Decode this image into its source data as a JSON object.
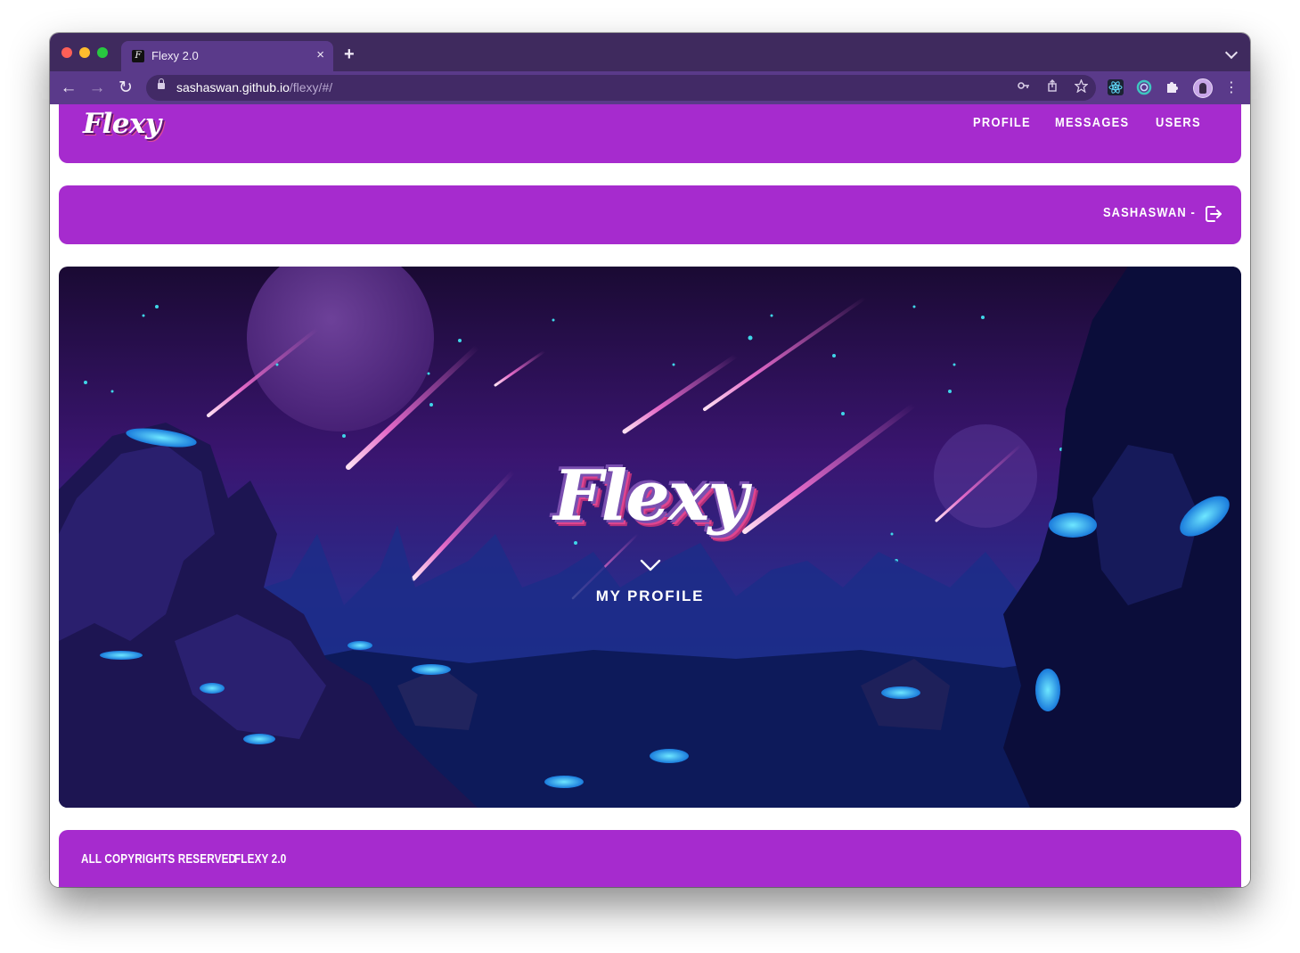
{
  "browser": {
    "tab_title": "Flexy 2.0",
    "tab_close": "×",
    "new_tab": "+",
    "url_domain": "sashaswan.github.io",
    "url_path": "/flexy/#/",
    "back": "←",
    "forward": "→",
    "reload": "↻",
    "menu": "⋮"
  },
  "header": {
    "logo": "Flexy",
    "nav": [
      {
        "label": "PROFILE"
      },
      {
        "label": "MESSAGES"
      },
      {
        "label": "USERS"
      }
    ]
  },
  "userbar": {
    "username": "SASHASWAN -"
  },
  "hero": {
    "title": "Flexy",
    "link": "MY PROFILE"
  },
  "footer": {
    "copyright": "ALL COPYRIGHTS RESERVED",
    "version": "FLEXY 2.0"
  },
  "colors": {
    "brand": "#a62bce",
    "browser_chrome": "#5a3a8a",
    "title_outline": "#7a4fb0",
    "title_accent": "#e0458f"
  }
}
